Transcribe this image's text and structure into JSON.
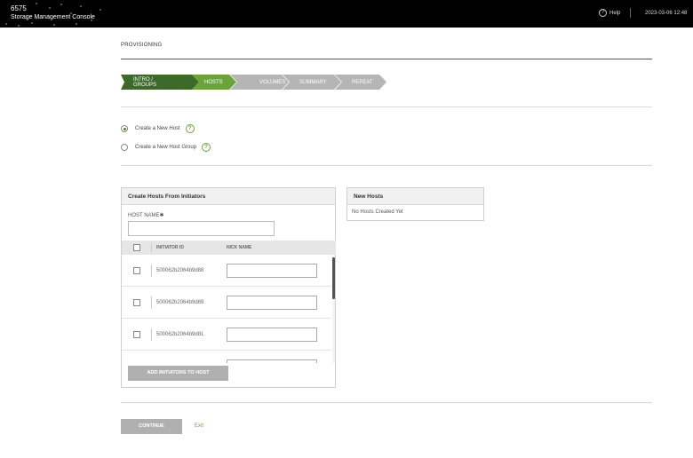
{
  "app": {
    "model": "6575",
    "name": "Storage Management Console",
    "help_label": "Help",
    "datetime": "2023-03-06 12:48"
  },
  "page": {
    "title": "PROVISIONING"
  },
  "steps": [
    {
      "label": "INTRO / GROUPS",
      "state": "completed",
      "color": "#3d6a2a"
    },
    {
      "label": "HOSTS",
      "state": "active",
      "color": "#6aa339"
    },
    {
      "label": "VOLUMES",
      "state": "pending",
      "color": "#b5b5b5"
    },
    {
      "label": "SUMMARY",
      "state": "pending",
      "color": "#b5b5b5"
    },
    {
      "label": "REPEAT",
      "state": "pending",
      "color": "#b5b5b5"
    }
  ],
  "options": {
    "new_host": {
      "label": "Create a New Host",
      "selected": true
    },
    "new_host_group": {
      "label": "Create a New Host Group",
      "selected": false
    }
  },
  "create_panel": {
    "title": "Create Hosts From Initiators",
    "host_name_label": "HOST NAME✱",
    "host_name_value": "",
    "columns": {
      "initiator_id": "INITIATOR ID",
      "nickname": "NICK NAME"
    },
    "rows": [
      {
        "initiator_id": "500062b2064b9d88",
        "nickname": "",
        "checked": false
      },
      {
        "initiator_id": "500062b2064b9d89",
        "nickname": "",
        "checked": false
      },
      {
        "initiator_id": "500062b2064b9d81",
        "nickname": "",
        "checked": false
      }
    ],
    "add_button": "ADD INITIATORS TO HOST"
  },
  "new_hosts_panel": {
    "title": "New Hosts",
    "empty_text": "No Hosts Created Yet"
  },
  "footer": {
    "continue": "CONTINUE",
    "exit": "Exit"
  },
  "colors": {
    "accent_green": "#6aa339",
    "dark_green": "#3d6a2a",
    "disabled_grey": "#b0b0b0"
  }
}
